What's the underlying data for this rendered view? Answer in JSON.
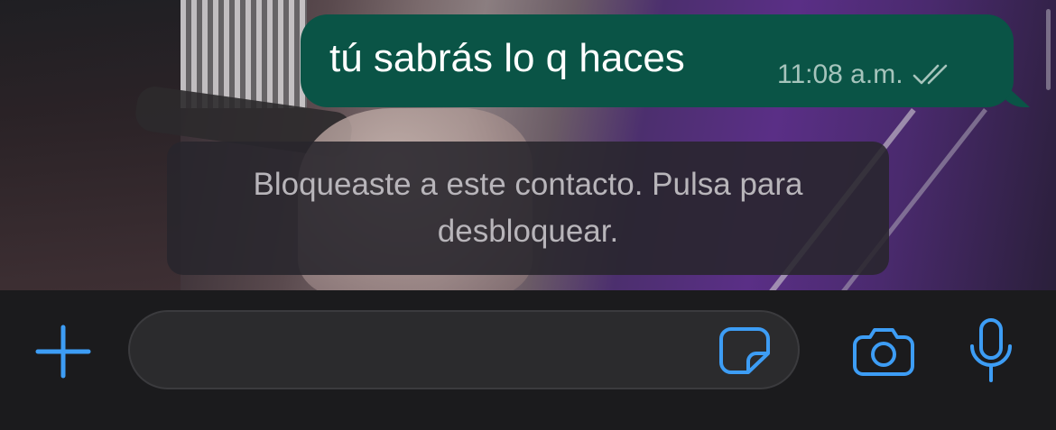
{
  "chat": {
    "outgoing_message": {
      "text": "tú sabrás lo q haces",
      "time": "11:08 a.m.",
      "status_icon": "double-check-icon"
    },
    "system_notice": {
      "text": "Bloqueaste a este contacto. Pulsa para desbloquear."
    }
  },
  "input_bar": {
    "attach_icon": "plus-icon",
    "message_placeholder": "",
    "sticker_icon": "sticker-icon",
    "camera_icon": "camera-icon",
    "mic_icon": "microphone-icon"
  },
  "colors": {
    "accent": "#3d9df5",
    "outgoing_bubble": "#0a5446",
    "background": "#1b1b1d"
  }
}
